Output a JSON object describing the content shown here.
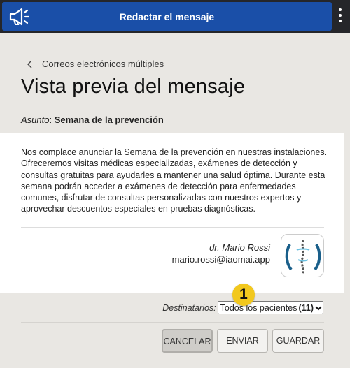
{
  "header": {
    "title": "Redactar el mensaje"
  },
  "nav": {
    "back_label": "Correos electrónicos múltiples"
  },
  "page": {
    "title": "Vista previa del mensaje"
  },
  "subject": {
    "label": "Asunto",
    "separator": ": ",
    "value": "Semana de la prevención"
  },
  "message": {
    "body": "Nos complace anunciar la Semana de la prevención en nuestras instalaciones. Ofreceremos visitas médicas especializadas, exámenes de detección y consultas gratuitas para ayudarles a mantener una salud óptima. Durante esta semana podrán acceder a exámenes de detección para enfermedades comunes, disfrutar de consultas personalizadas con nuestros expertos y aprovechar descuentos especiales en pruebas diagnósticas.",
    "signature_name": "dr. Mario Rossi",
    "signature_email": "mario.rossi@iaomai.app"
  },
  "recipients": {
    "label": "Destinatarios:",
    "selected": "Todos los pacientes",
    "count": "(11)"
  },
  "badge": {
    "number": "1"
  },
  "buttons": {
    "cancel": "CANCELAR",
    "send": "ENVIAR",
    "save": "GUARDAR"
  },
  "icons": {
    "megaphone": "megaphone-icon",
    "menu": "kebab-menu-icon",
    "back": "chevron-left-icon",
    "dropdown": "chevron-down-icon",
    "logo": "spine-logo"
  },
  "colors": {
    "header": "#1a4fa8",
    "badge": "#f2c81e",
    "background": "#e9e7e3"
  }
}
